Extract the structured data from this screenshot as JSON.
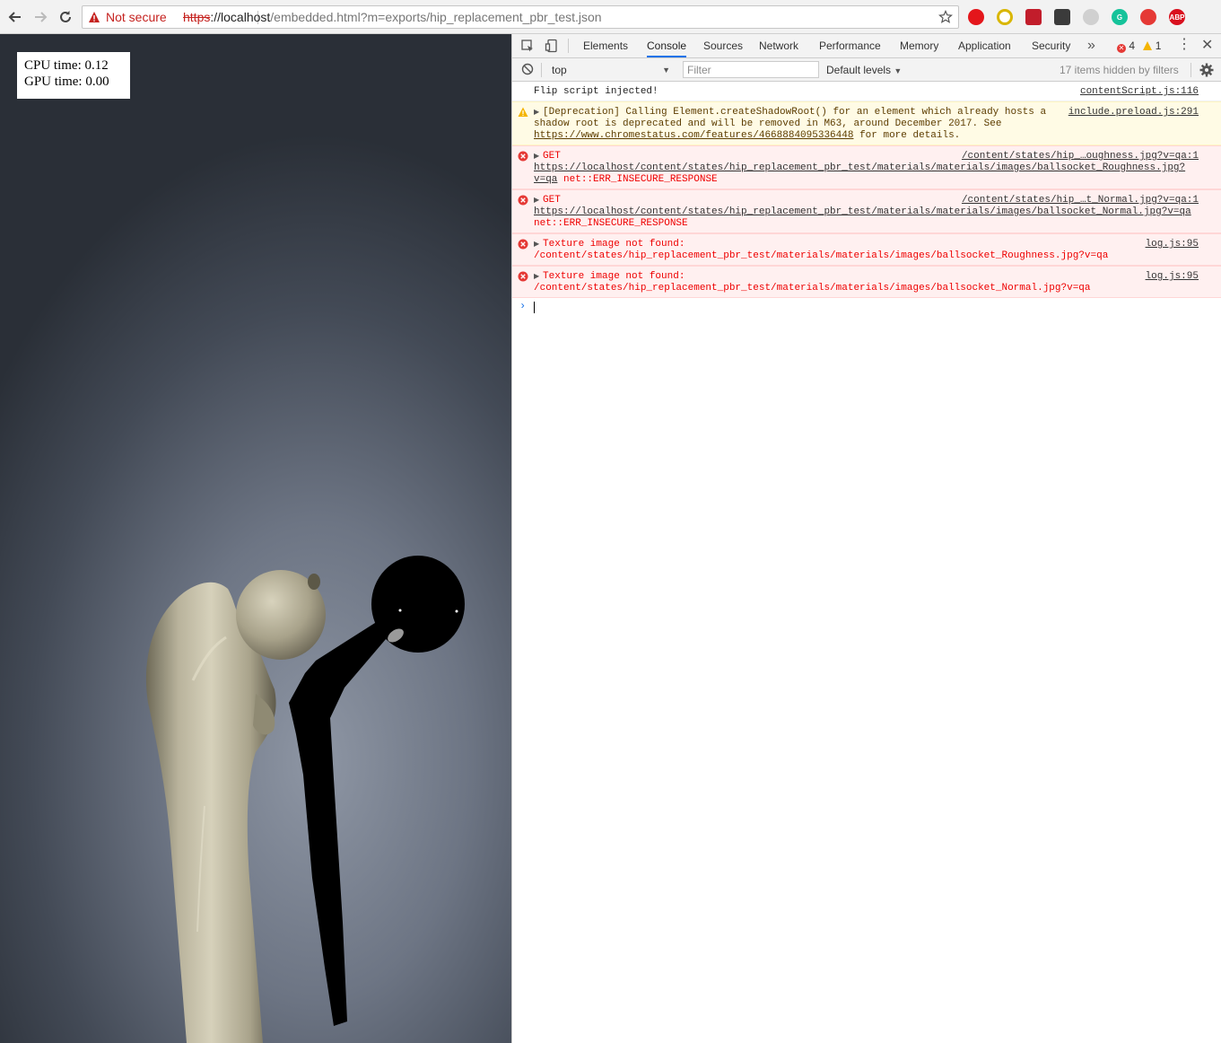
{
  "browser": {
    "security_label": "Not secure",
    "url_scheme": "https",
    "url_host": "://localhost",
    "url_path": "/embedded.html?m=exports/hip_replacement_pbr_test.json",
    "extensions": [
      {
        "name": "opera-icon",
        "color": "#e4161b",
        "label": ""
      },
      {
        "name": "chromecast-icon",
        "color": "#d9b600",
        "label": ""
      },
      {
        "name": "cube-extension-icon",
        "color": "#c21d2b",
        "label": ""
      },
      {
        "name": "terminal-extension-icon",
        "color": "#3b3b3b",
        "label": ""
      },
      {
        "name": "sync-extension-icon",
        "color": "#d0d0d0",
        "label": ""
      },
      {
        "name": "grammarly-icon",
        "color": "#15c39a",
        "label": "G"
      },
      {
        "name": "block-extension-icon",
        "color": "#e53935",
        "label": ""
      },
      {
        "name": "adblock-plus-icon",
        "color": "#d9101e",
        "label": "ABP"
      }
    ]
  },
  "stats": {
    "cpu": "CPU time: 0.12",
    "gpu": "GPU time: 0.00"
  },
  "devtools": {
    "tabs": [
      "Elements",
      "Console",
      "Sources",
      "Network",
      "Performance",
      "Memory",
      "Application",
      "Security"
    ],
    "active_tab": "Console",
    "more_tabs": "»",
    "error_count": "4",
    "warning_count": "1",
    "context": "top",
    "filter_placeholder": "Filter",
    "levels": "Default levels",
    "hidden_info": "17 items hidden by filters"
  },
  "console": {
    "messages": [
      {
        "level": "info",
        "text": "Flip script injected!",
        "source": "contentScript.js:116"
      },
      {
        "level": "warning",
        "text": "[Deprecation] Calling Element.createShadowRoot() for an element which already hosts a shadow root is deprecated and will be removed in M63, around December 2017. See ",
        "link": "https://www.chromestatus.com/features/4668884095336448",
        "text_after": " for more details.",
        "source": "include.preload.js:291"
      },
      {
        "level": "error",
        "method": "GET",
        "url": "https://localhost/content/states/hip_replacement_pbr_test/materials/materials/images/ballsocket_Roughness.jpg?v=qa",
        "status": "net::ERR_INSECURE_RESPONSE",
        "source": "/content/states/hip_…oughness.jpg?v=qa:1"
      },
      {
        "level": "error",
        "method": "GET",
        "url": "https://localhost/content/states/hip_replacement_pbr_test/materials/materials/images/ballsocket_Normal.jpg?v=qa",
        "status": "net::ERR_INSECURE_RESPONSE",
        "source": "/content/states/hip_…t_Normal.jpg?v=qa:1"
      },
      {
        "level": "error",
        "text": "Texture image not found:",
        "path": "/content/states/hip_replacement_pbr_test/materials/materials/images/ballsocket_Roughness.jpg?v=qa",
        "source": "log.js:95"
      },
      {
        "level": "error",
        "text": "Texture image not found:",
        "path": "/content/states/hip_replacement_pbr_test/materials/materials/images/ballsocket_Normal.jpg?v=qa",
        "source": "log.js:95"
      }
    ],
    "prompt_symbol": "›"
  }
}
